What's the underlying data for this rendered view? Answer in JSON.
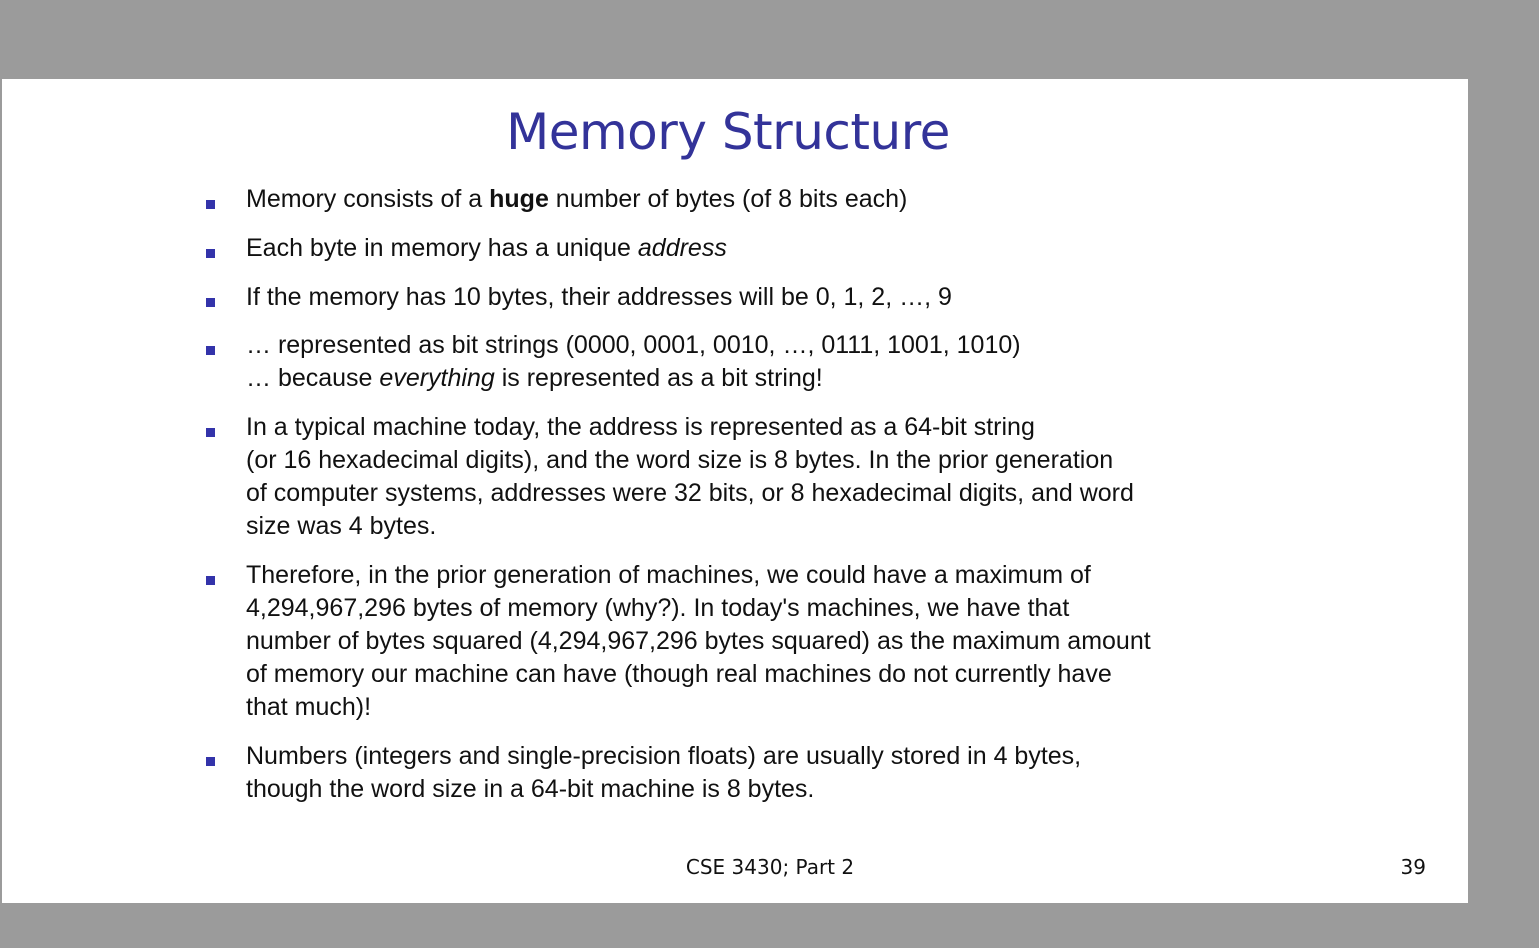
{
  "slide": {
    "title": "Memory Structure",
    "bullets": [
      {
        "lines": [
          [
            {
              "text": "Memory consists of a "
            },
            {
              "text": "huge",
              "style": "bold"
            },
            {
              "text": " number of bytes (of 8 bits each)"
            }
          ]
        ]
      },
      {
        "lines": [
          [
            {
              "text": "Each byte in memory has a unique "
            },
            {
              "text": "address",
              "style": "italic"
            }
          ]
        ]
      },
      {
        "lines": [
          [
            {
              "text": "If the memory has 10 bytes, their addresses will be 0, 1, 2, …, 9"
            }
          ]
        ]
      },
      {
        "lines": [
          [
            {
              "text": "… represented as bit strings (0000, 0001, 0010, …, 0111, 1001, 1010)"
            }
          ],
          [
            {
              "text": "… because "
            },
            {
              "text": "everything",
              "style": "italic"
            },
            {
              "text": " is represented as a bit string!"
            }
          ]
        ]
      },
      {
        "lines": [
          [
            {
              "text": "In a typical machine today, the address is represented as a 64-bit string"
            }
          ],
          [
            {
              "text": "(or 16 hexadecimal digits), and the word size is 8 bytes. In the prior generation"
            }
          ],
          [
            {
              "text": "of computer systems, addresses were 32 bits, or 8 hexadecimal digits, and word"
            }
          ],
          [
            {
              "text": "size was 4 bytes."
            }
          ]
        ]
      },
      {
        "lines": [
          [
            {
              "text": "Therefore, in the prior generation of machines, we could have a maximum of"
            }
          ],
          [
            {
              "text": "4,294,967,296 bytes of memory (why?). In today's machines, we have that"
            }
          ],
          [
            {
              "text": "number of bytes squared (4,294,967,296 bytes squared) as the maximum amount"
            }
          ],
          [
            {
              "text": "of memory our machine can have (though real machines do not currently have"
            }
          ],
          [
            {
              "text": "that much)!"
            }
          ]
        ]
      },
      {
        "lines": [
          [
            {
              "text": "Numbers (integers and single-precision floats) are usually stored in 4 bytes,"
            }
          ],
          [
            {
              "text": "though the word size in a 64-bit machine is 8 bytes."
            }
          ]
        ]
      }
    ],
    "footer": "CSE 3430; Part 2",
    "page_number": "39",
    "colors": {
      "title": "#333399",
      "bullet_marker": "#3333aa",
      "background_frame": "#9b9b9b",
      "slide_background": "#ffffff"
    }
  }
}
